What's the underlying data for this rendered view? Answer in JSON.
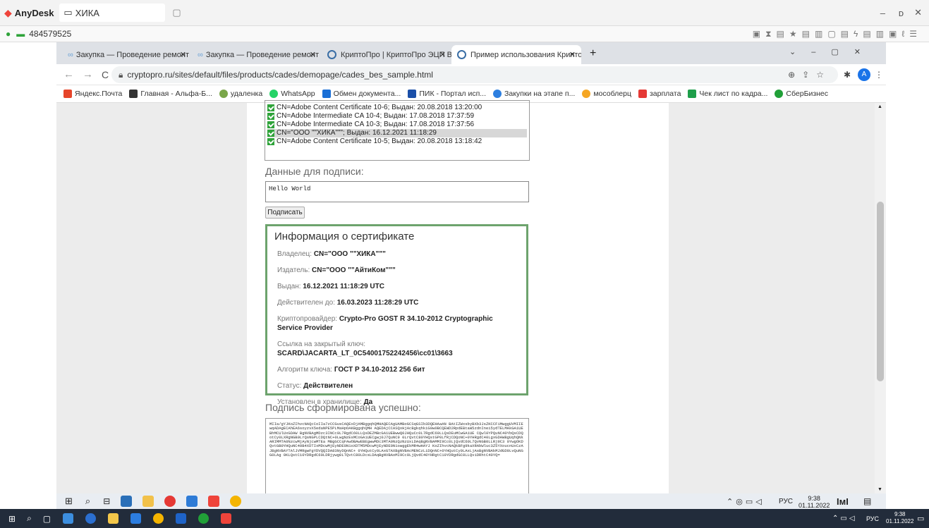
{
  "anydesk": {
    "app_name": "AnyDesk",
    "tab_label": "ХИКА",
    "session_id": "484579525"
  },
  "browser": {
    "tabs": [
      {
        "label": "Закупка — Проведение ремонт"
      },
      {
        "label": "Закупка — Проведение ремонт"
      },
      {
        "label": "КриптоПро | КриптоПро ЭЦП В"
      },
      {
        "label": "Пример использования Крипто"
      }
    ],
    "url": "cryptopro.ru/sites/default/files/products/cades/demopage/cades_bes_sample.html",
    "profile_initial": "A",
    "bookmarks": [
      "Яндекс.Почта",
      "Главная - Альфа-Б...",
      "удаленка",
      "WhatsApp",
      "Обмен документа...",
      "ПИК - Портал исп...",
      "Закупки на этапе п...",
      "мособлерц",
      "зарплата",
      "Чек лист по кадра...",
      "СберБизнес"
    ]
  },
  "page": {
    "certificates": [
      "CN=Adobe Content Certificate 10-6; Выдан: 20.08.2018 13:20:00",
      "CN=Adobe Intermediate CA 10-4; Выдан: 17.08.2018 17:37:59",
      "CN=Adobe Intermediate CA 10-3; Выдан: 17.08.2018 17:37:56",
      "CN=\"ООО \"\"ХИКА\"\"\"; Выдан: 16.12.2021 11:18:29",
      "CN=Adobe Content Certificate 10-5; Выдан: 20.08.2018 13:18:42"
    ],
    "data_label": "Данные для подписи:",
    "data_value": "Hello World",
    "sign_button": "Подписать",
    "info": {
      "title": "Информация о сертификате",
      "owner_label": "Владелец:",
      "owner": "CN=\"ООО \"\"ХИКА\"\"\"",
      "issuer_label": "Издатель:",
      "issuer": "CN=\"ООО \"\"АйтиКом\"\"\"",
      "issued_label": "Выдан:",
      "issued": "16.12.2021 11:18:29 UTC",
      "valid_label": "Действителен до:",
      "valid": "16.03.2023 11:28:29 UTC",
      "provider_label": "Криптопровайдер:",
      "provider": "Crypto-Pro GOST R 34.10-2012 Cryptographic Service Provider",
      "key_link_label": "Ссылка на закрытый ключ:",
      "key_link": "SCARD\\JACARTA_LT_0C54001752242456\\cc01\\3663",
      "algo_label": "Алгоритм ключа:",
      "algo": "ГОСТ Р 34.10-2012 256 бит",
      "status_label": "Статус:",
      "status": "Действителен",
      "installed_label": "Установлен в хранилище:",
      "installed": "Да"
    },
    "sig_label": "Подпись сформирована успешно:",
    "signature": "MIIa/gYJKoZIhvcNAQcCoIIa7zCCGusCAQExDjAMBggqhQMHAQECAgUAMBoGCSqGSIb3DQEHAaAN BAtIZWxsbyBXb3JsZKCCFiMwggUVMIIEwqADAgECAhEA6soyzvX5edaNPE5PLMaHpOAKBggqhQMH AQEDAjCCASQxHjAcBgkqhkiG9w0BCQEWD2RpdEBtaW5zdnInei5ydTELMAkGA1UEBhMCUlUxGDAW BgNVBAgMDzc3INCc0L7RgdC60LLQsDEZMBcGA1UEBwwQ0JHQuCc0L7RgdC60LLQsDEuMCwGA1UE CQwl0YPQuNC40YbQsCDQotCy0LXRgNGB0LrQsNGPLCDQtNC+0LwgNzEsMCoGA1UECgwj0J7QuNC9 0LrQvtC80YHQstGP0LfRjCDQoNC+0YHRgdC40LgxGDAWBgUqhQNkARIMMTA0NzcwMjAyNjcwMTEa MBgGCCqFAwOBAwEBEgwwMDc3MTA0NzQzNzUxLDAqBgNVBAMMI9Cc0LjQvdC60L7QvNGB0LLRj9C3 0YwgOKDQvtGB0YHQuNC40B4XDTIxMDcwMjEyNDE0N1oXDTM5MDcwMjEyNDE0N1owggEkMR4wHAYJ KoZIhvcNAQkBFg9kaXRAbWluc3Z5YXoucnUxCzAJBgNVBAYTAlJVMRgwFgYDVQQIDA83NyDQnNC+ 0YHQutCy0LAxGTAXBgNVBAcMENCzLiDQnNC+0YHQutCy0LAxLjAsBgNVBAkMJdGD0LvQuNGG0LAg 0KLQstC10YDRgdC60LDRjywg0LTQvtC80LDcsLDAqBgNVBAoMI9Cc0LjQvdC40YHRgtC10YDRgdGC0LLQviDRhtC40YQ="
  },
  "remote_tray": {
    "lang": "РУС",
    "time": "9:38",
    "date": "01.11.2022"
  },
  "host_tray": {
    "lang": "РУС",
    "time": "9:38",
    "date": "01.11.2022"
  }
}
